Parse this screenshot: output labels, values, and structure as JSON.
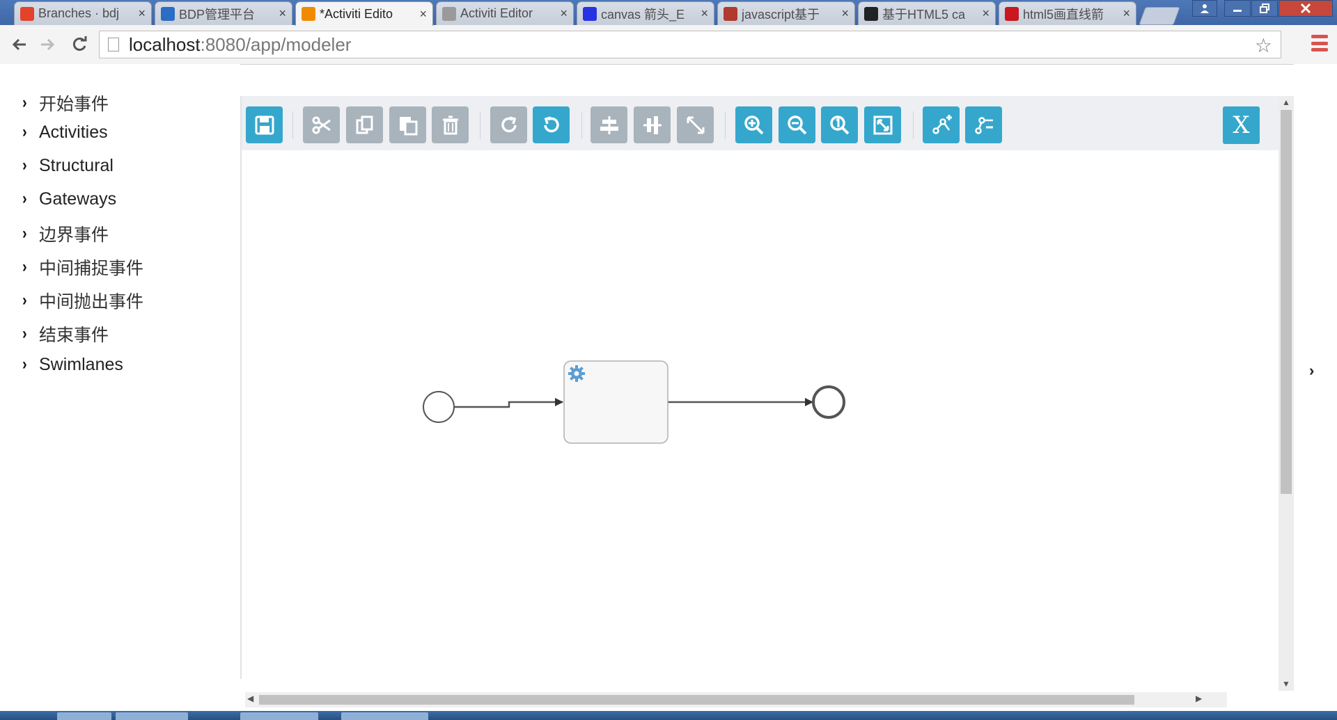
{
  "browser": {
    "tabs": [
      {
        "label": "Branches · bdj",
        "icon": "gitlab-fox-icon",
        "color": "#e2432a"
      },
      {
        "label": "BDP管理平台",
        "icon": "loading-spinner-icon",
        "color": "#2b6cc4"
      },
      {
        "label": "*Activiti Edito",
        "icon": "activiti-icon",
        "color": "#f08a00",
        "active": true
      },
      {
        "label": "Activiti Editor",
        "icon": "page-icon",
        "color": "#9a9a9a"
      },
      {
        "label": "canvas 箭头_E",
        "icon": "baidu-paw-icon",
        "color": "#2932e1"
      },
      {
        "label": "javascript基于",
        "icon": "b-logo-icon",
        "color": "#b03a2e"
      },
      {
        "label": "基于HTML5 ca",
        "icon": "penguin-icon",
        "color": "#222222"
      },
      {
        "label": "html5画直线箭",
        "icon": "csdn-c-icon",
        "color": "#c9181f"
      }
    ],
    "tab_close_glyph": "×",
    "address": {
      "host": "localhost",
      "path": ":8080/app/modeler"
    }
  },
  "palette": {
    "items": [
      {
        "label": "开始事件",
        "cjk": true
      },
      {
        "label": "Activities",
        "cjk": false
      },
      {
        "label": "Structural",
        "cjk": false
      },
      {
        "label": "Gateways",
        "cjk": false
      },
      {
        "label": "边界事件",
        "cjk": true
      },
      {
        "label": "中间捕捉事件",
        "cjk": true
      },
      {
        "label": "中间抛出事件",
        "cjk": true
      },
      {
        "label": "结束事件",
        "cjk": true
      },
      {
        "label": "Swimlanes",
        "cjk": false
      }
    ]
  },
  "toolbar": {
    "buttons": [
      {
        "name": "save-button",
        "icon": "save-icon",
        "style": "blue"
      },
      {
        "name": "cut-button",
        "icon": "scissors-icon",
        "style": "gray"
      },
      {
        "name": "copy-button",
        "icon": "copy-icon",
        "style": "gray"
      },
      {
        "name": "paste-button",
        "icon": "paste-icon",
        "style": "gray"
      },
      {
        "name": "delete-button",
        "icon": "trash-icon",
        "style": "gray"
      },
      {
        "name": "redo-button",
        "icon": "redo-icon",
        "style": "gray"
      },
      {
        "name": "undo-button",
        "icon": "undo-icon",
        "style": "blue"
      },
      {
        "name": "align-vertical-button",
        "icon": "align-vertical-icon",
        "style": "gray"
      },
      {
        "name": "align-horizontal-button",
        "icon": "align-horizontal-icon",
        "style": "gray"
      },
      {
        "name": "same-size-button",
        "icon": "same-size-icon",
        "style": "gray"
      },
      {
        "name": "zoom-in-button",
        "icon": "zoom-in-icon",
        "style": "blue"
      },
      {
        "name": "zoom-out-button",
        "icon": "zoom-out-icon",
        "style": "blue"
      },
      {
        "name": "zoom-actual-button",
        "icon": "zoom-actual-icon",
        "style": "blue"
      },
      {
        "name": "zoom-fit-button",
        "icon": "zoom-fit-icon",
        "style": "blue"
      },
      {
        "name": "add-bendpoint-button",
        "icon": "add-bendpoint-icon",
        "style": "blue"
      },
      {
        "name": "remove-bendpoint-button",
        "icon": "remove-bendpoint-icon",
        "style": "blue"
      }
    ],
    "close_label": "X"
  },
  "diagram": {
    "elements": [
      "start-event",
      "service-task",
      "end-event"
    ],
    "task_icon": "gear-icon"
  },
  "colors": {
    "accent": "#35a7cc",
    "button_gray": "#a9b3bc",
    "toolbar_bg": "#edeff2"
  }
}
